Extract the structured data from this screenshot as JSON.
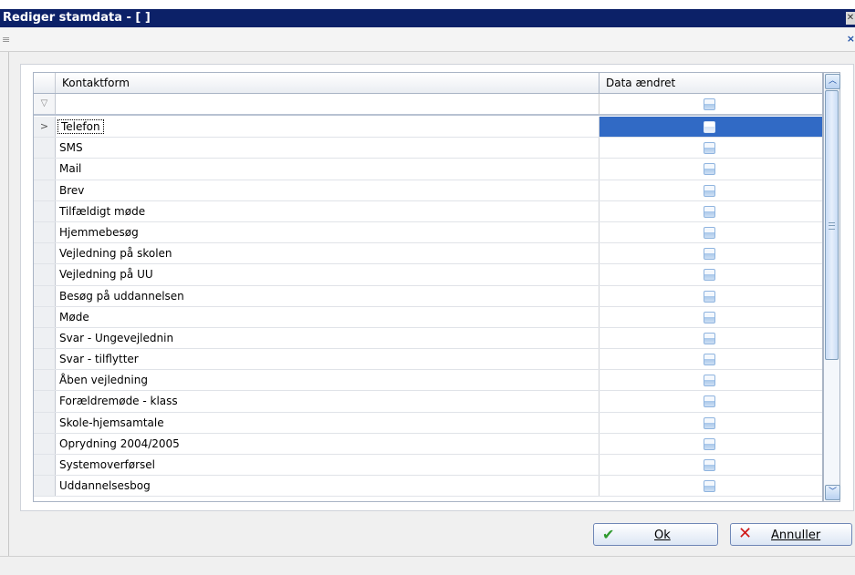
{
  "window": {
    "title": "Rediger stamdata - [ ]",
    "close_glyph": "✕",
    "toolbar_grip_glyph": "≡",
    "toolbar_pin_glyph": "×"
  },
  "grid": {
    "columns": [
      "Kontaktform",
      "Data ændret"
    ],
    "filter_icon": "filter-icon",
    "selected_row_index": 0,
    "rows": [
      {
        "kontaktform": "Telefon",
        "data_aendret": false
      },
      {
        "kontaktform": "SMS",
        "data_aendret": false
      },
      {
        "kontaktform": "Mail",
        "data_aendret": false
      },
      {
        "kontaktform": "Brev",
        "data_aendret": false
      },
      {
        "kontaktform": "Tilfældigt møde",
        "data_aendret": false
      },
      {
        "kontaktform": "Hjemmebesøg",
        "data_aendret": false
      },
      {
        "kontaktform": "Vejledning på skolen",
        "data_aendret": false
      },
      {
        "kontaktform": "Vejledning på UU",
        "data_aendret": false
      },
      {
        "kontaktform": "Besøg på uddannelsen",
        "data_aendret": false
      },
      {
        "kontaktform": "Møde",
        "data_aendret": false
      },
      {
        "kontaktform": "Svar - Ungevejlednin",
        "data_aendret": false
      },
      {
        "kontaktform": "Svar - tilflytter",
        "data_aendret": false
      },
      {
        "kontaktform": "Åben vejledning",
        "data_aendret": false
      },
      {
        "kontaktform": "Forældremøde - klass",
        "data_aendret": false
      },
      {
        "kontaktform": "Skole-hjemsamtale",
        "data_aendret": false
      },
      {
        "kontaktform": "Oprydning 2004/2005",
        "data_aendret": false
      },
      {
        "kontaktform": "Systemoverførsel",
        "data_aendret": false
      },
      {
        "kontaktform": "Uddannelsesbog",
        "data_aendret": false
      }
    ]
  },
  "buttons": {
    "ok_label": "Ok",
    "cancel_label": "Annuller"
  },
  "colors": {
    "titlebar": "#0c2168",
    "selection": "#316ac5",
    "ok_icon": "#2f9a2f",
    "cancel_icon": "#d01818"
  }
}
